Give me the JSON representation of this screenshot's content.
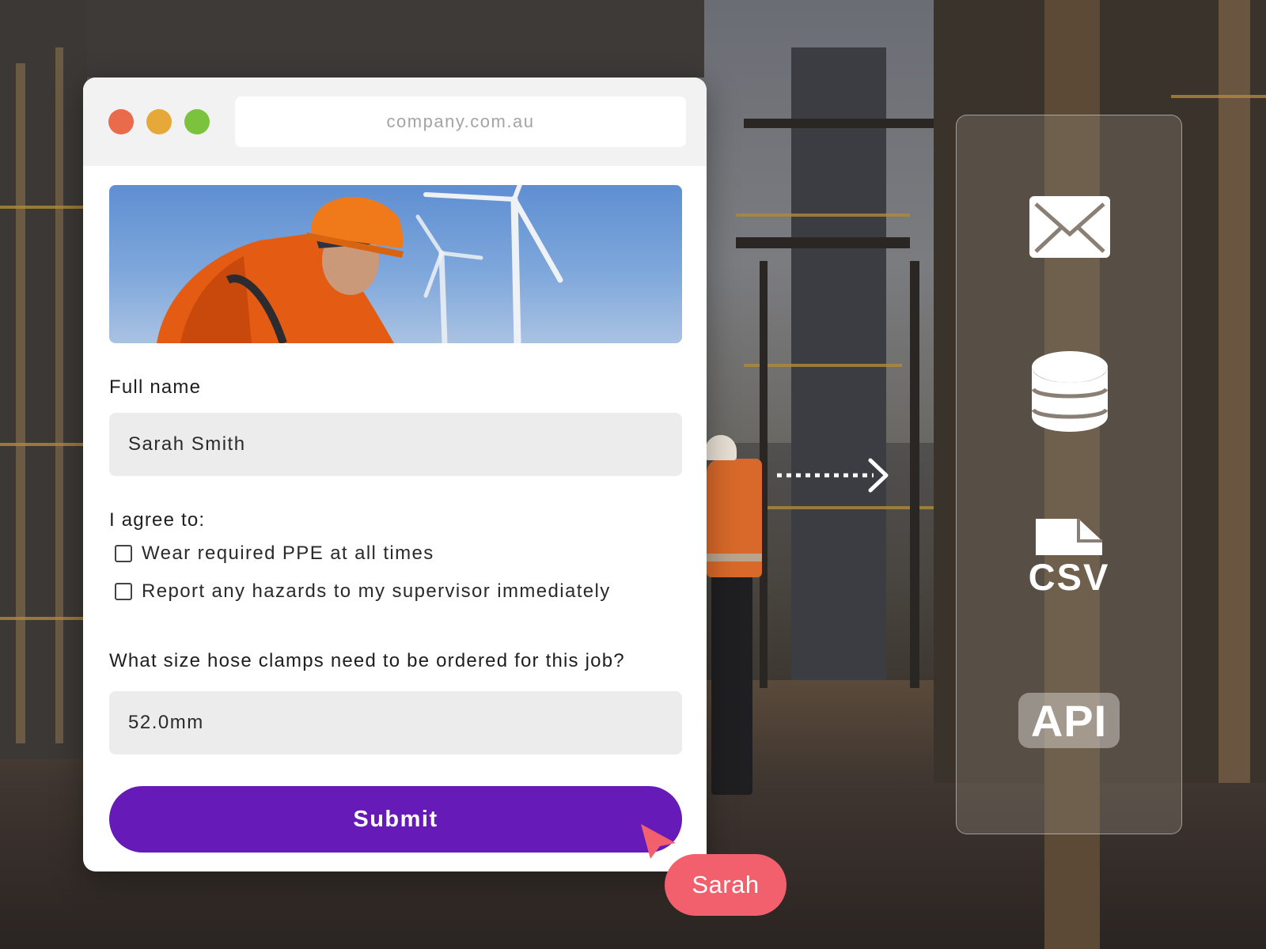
{
  "browser": {
    "url": "company.com.au"
  },
  "form": {
    "full_name_label": "Full name",
    "full_name_value": "Sarah Smith",
    "agree_label": "I agree to:",
    "checkboxes": [
      {
        "label": "Wear required PPE at all times",
        "checked": false
      },
      {
        "label": "Report any hazards to my supervisor immediately",
        "checked": false
      }
    ],
    "question_label": "What size hose clamps need to be ordered for this job?",
    "question_value": "52.0mm",
    "submit_label": "Submit"
  },
  "collaborator": {
    "name": "Sarah",
    "color": "#f2606e"
  },
  "destinations": {
    "icons": [
      "mail-icon",
      "database-icon",
      "csv-file-icon",
      "api-icon"
    ],
    "csv_label": "CSV",
    "api_label": "API"
  },
  "colors": {
    "submit_bg": "#661bb8",
    "traffic_red": "#ea6a4c",
    "traffic_yellow": "#e7a83a",
    "traffic_green": "#7bc23d"
  }
}
